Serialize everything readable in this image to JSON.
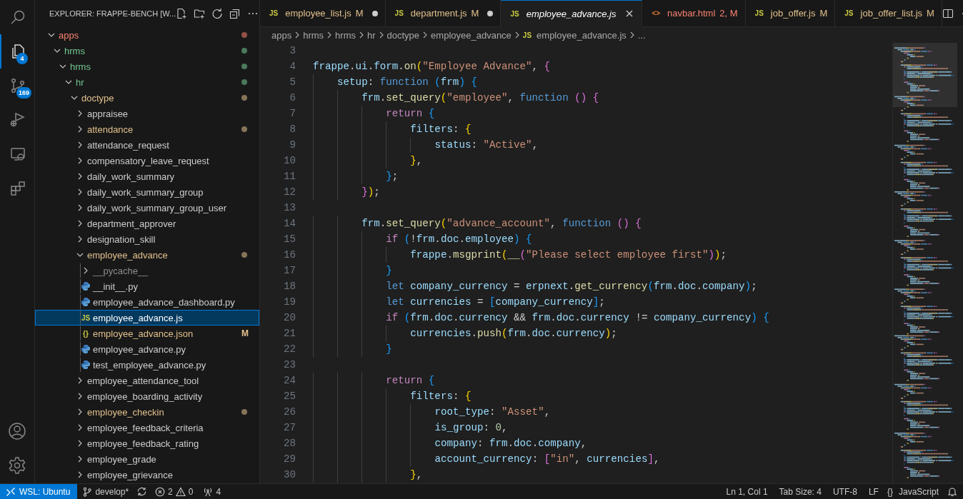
{
  "activity_bar": {
    "items": [
      {
        "kind": "search",
        "selected": false
      },
      {
        "kind": "explorer",
        "selected": true,
        "badge": "4"
      },
      {
        "kind": "scm",
        "selected": false,
        "badge": "169"
      },
      {
        "kind": "debug",
        "selected": false
      },
      {
        "kind": "remote",
        "selected": false
      },
      {
        "kind": "extensions",
        "selected": false
      }
    ],
    "bottom": [
      {
        "kind": "account"
      },
      {
        "kind": "settings"
      }
    ]
  },
  "explorer": {
    "title": "EXPLORER: FRAPPE-BENCH [W...",
    "tree": [
      {
        "name": "apps",
        "expanded": true,
        "selected": false,
        "color": "#f88070",
        "dot": true,
        "children": [
          {
            "name": "hrms",
            "expanded": true,
            "selected": false,
            "color": "#73c991",
            "dot": true,
            "children": [
              {
                "name": "hrms",
                "expanded": true,
                "selected": false,
                "color": "#73c991",
                "dot": true,
                "children": [
                  {
                    "name": "hr",
                    "expanded": true,
                    "selected": false,
                    "color": "#73c991",
                    "dot": true,
                    "children": [
                      {
                        "name": "doctype",
                        "expanded": true,
                        "selected": false,
                        "color": "#e2c08d",
                        "dot": true,
                        "children": [
                          {
                            "name": "appraisee",
                            "expanded": false,
                            "selected": false
                          },
                          {
                            "name": "attendance",
                            "expanded": false,
                            "selected": false,
                            "color": "#e2c08d",
                            "dot": true
                          },
                          {
                            "name": "attendance_request",
                            "expanded": false,
                            "selected": false
                          },
                          {
                            "name": "compensatory_leave_request",
                            "expanded": false,
                            "selected": false
                          },
                          {
                            "name": "daily_work_summary",
                            "expanded": false,
                            "selected": false
                          },
                          {
                            "name": "daily_work_summary_group",
                            "expanded": false,
                            "selected": false
                          },
                          {
                            "name": "daily_work_summary_group_user",
                            "expanded": false,
                            "selected": false
                          },
                          {
                            "name": "department_approver",
                            "expanded": false,
                            "selected": false
                          },
                          {
                            "name": "designation_skill",
                            "expanded": false,
                            "selected": false
                          },
                          {
                            "name": "employee_advance",
                            "expanded": true,
                            "selected": false,
                            "color": "#e2c08d",
                            "dot": true,
                            "children": [
                              {
                                "name": "__pycache__",
                                "expanded": false,
                                "selected": false,
                                "color": "#8c8c8c"
                              },
                              {
                                "name": "__init__.py",
                                "selected": false
                              },
                              {
                                "name": "employee_advance_dashboard.py",
                                "selected": false
                              },
                              {
                                "name": "employee_advance.js",
                                "glyph": "JS",
                                "selected": true
                              },
                              {
                                "name": "employee_advance.json",
                                "glyph": "{}",
                                "selected": false,
                                "color": "#e2c08d",
                                "badge": "M"
                              },
                              {
                                "name": "employee_advance.py",
                                "selected": false
                              },
                              {
                                "name": "test_employee_advance.py",
                                "selected": false
                              }
                            ]
                          },
                          {
                            "name": "employee_attendance_tool",
                            "expanded": false,
                            "selected": false
                          },
                          {
                            "name": "employee_boarding_activity",
                            "expanded": false,
                            "selected": false
                          },
                          {
                            "name": "employee_checkin",
                            "expanded": false,
                            "selected": false,
                            "color": "#e2c08d",
                            "dot": true
                          },
                          {
                            "name": "employee_feedback_criteria",
                            "expanded": false,
                            "selected": false
                          },
                          {
                            "name": "employee_feedback_rating",
                            "expanded": false,
                            "selected": false
                          },
                          {
                            "name": "employee_grade",
                            "expanded": false,
                            "selected": false
                          },
                          {
                            "name": "employee_grievance",
                            "expanded": false,
                            "selected": false
                          }
                        ]
                      }
                    ]
                  }
                ]
              }
            ]
          }
        ]
      }
    ]
  },
  "tabs": [
    {
      "label": "employee_list.js",
      "glyph": "JS",
      "badge": "M",
      "color": "#e2c08d",
      "dirty": true,
      "selected": false,
      "preview": false
    },
    {
      "label": "department.js",
      "glyph": "JS",
      "badge": "M",
      "color": "#e2c08d",
      "dirty": true,
      "selected": false,
      "preview": false
    },
    {
      "label": "employee_advance.js",
      "glyph": "JS",
      "dirty": false,
      "selected": true,
      "preview": true
    },
    {
      "label": "navbar.html",
      "glyph": "<>",
      "badge": "2, M",
      "color": "#f88070",
      "dirty": false,
      "selected": false,
      "preview": false
    },
    {
      "label": "job_offer.js",
      "glyph": "JS",
      "badge": "M",
      "color": "#e2c08d",
      "dirty": false,
      "selected": false,
      "preview": false
    },
    {
      "label": "job_offer_list.js",
      "glyph": "JS",
      "badge": "M",
      "color": "#e2c08d",
      "dirty": false,
      "selected": false,
      "preview": false
    }
  ],
  "breadcrumbs": [
    {
      "label": "apps"
    },
    {
      "label": "hrms"
    },
    {
      "label": "hrms"
    },
    {
      "label": "hr"
    },
    {
      "label": "doctype"
    },
    {
      "label": "employee_advance"
    },
    {
      "label": "employee_advance.js",
      "glyph": "JS"
    },
    {
      "label": "..."
    }
  ],
  "code": [
    {
      "n": "3"
    },
    {
      "n": "4",
      "text": "frappe.ui.form.on(\"Employee Advance\", {"
    },
    {
      "n": "5",
      "text": "    setup: function (frm) {"
    },
    {
      "n": "6",
      "text": "        frm.set_query(\"employee\", function () {"
    },
    {
      "n": "7",
      "text": "            return {"
    },
    {
      "n": "8",
      "text": "                filters: {"
    },
    {
      "n": "9",
      "text": "                    status: \"Active\","
    },
    {
      "n": "10",
      "text": "                },"
    },
    {
      "n": "11",
      "text": "            };"
    },
    {
      "n": "12",
      "text": "        });"
    },
    {
      "n": "13"
    },
    {
      "n": "14",
      "text": "        frm.set_query(\"advance_account\", function () {"
    },
    {
      "n": "15",
      "text": "            if (!frm.doc.employee) {"
    },
    {
      "n": "16",
      "text": "                frappe.msgprint(__(\"Please select employee first\"));"
    },
    {
      "n": "17",
      "text": "            }"
    },
    {
      "n": "18",
      "text": "            let company_currency = erpnext.get_currency(frm.doc.company);"
    },
    {
      "n": "19",
      "text": "            let currencies = [company_currency];"
    },
    {
      "n": "20",
      "text": "            if (frm.doc.currency && frm.doc.currency != company_currency) {"
    },
    {
      "n": "21",
      "text": "                currencies.push(frm.doc.currency);"
    },
    {
      "n": "22",
      "text": "            }"
    },
    {
      "n": "23"
    },
    {
      "n": "24",
      "text": "            return {"
    },
    {
      "n": "25",
      "text": "                filters: {"
    },
    {
      "n": "26",
      "text": "                    root_type: \"Asset\","
    },
    {
      "n": "27",
      "text": "                    is_group: 0,"
    },
    {
      "n": "28",
      "text": "                    company: frm.doc.company,"
    },
    {
      "n": "29",
      "text": "                    account_currency: [\"in\", currencies],"
    },
    {
      "n": "30",
      "text": "                },"
    }
  ],
  "status_bar": {
    "remote": "WSL: Ubuntu",
    "branch": "develop*",
    "errors": "2",
    "warnings": "0",
    "ports": "4",
    "right": [
      {
        "label": "Ln 1, Col 1"
      },
      {
        "label": "Tab Size: 4"
      },
      {
        "label": "UTF-8"
      },
      {
        "label": "LF"
      },
      {
        "label": "JavaScript",
        "glyph": "{}"
      }
    ]
  }
}
